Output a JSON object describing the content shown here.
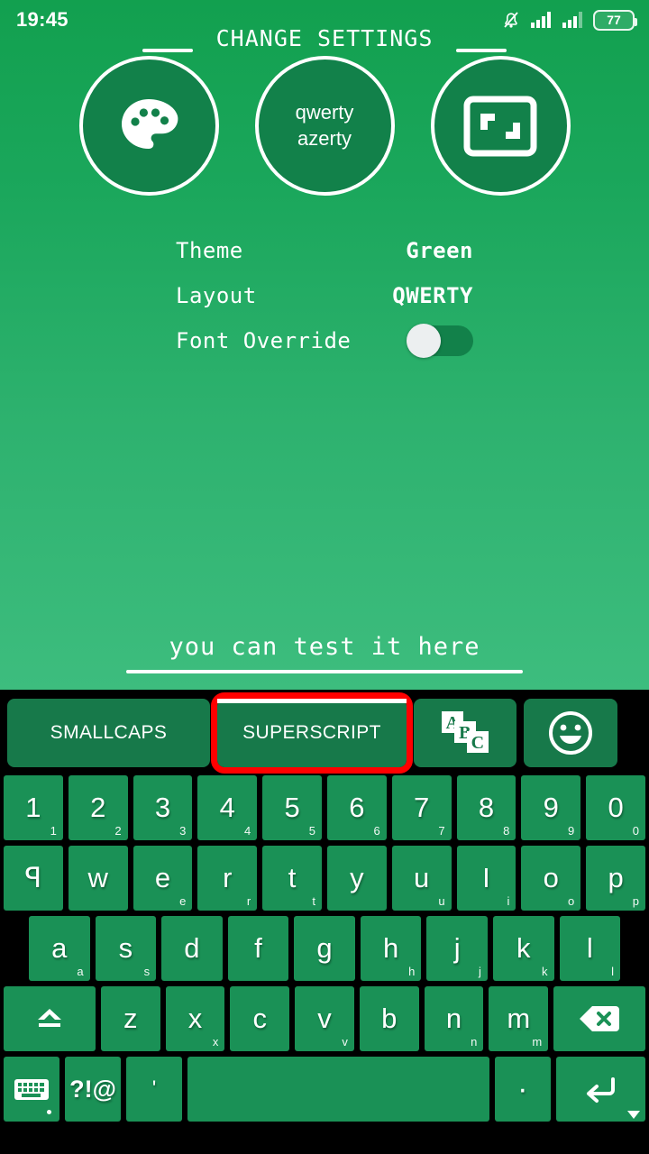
{
  "status_bar": {
    "clock": "19:45",
    "battery_percent": "77",
    "icons": [
      "bell-muted-icon",
      "signal-1-icon",
      "signal-2-icon",
      "battery-icon"
    ]
  },
  "header": {
    "title": "CHANGE SETTINGS"
  },
  "circle_buttons": [
    {
      "name": "theme-button",
      "icon": "palette-icon",
      "label": ""
    },
    {
      "name": "layout-button",
      "icon": "",
      "label_line1": "qwerty",
      "label_line2": "azerty"
    },
    {
      "name": "keyboard-size-button",
      "icon": "resize-icon",
      "label": ""
    }
  ],
  "settings": [
    {
      "label": "Theme",
      "value": "Green",
      "type": "text"
    },
    {
      "label": "Layout",
      "value": "QWERTY",
      "type": "text"
    },
    {
      "label": "Font Override",
      "value": "off",
      "type": "toggle"
    }
  ],
  "test_field": {
    "placeholder": "you can test it here",
    "value": ""
  },
  "toolbar": {
    "smallcaps_label": "SMALLCAPS",
    "superscript_label": "SUPERSCRIPT",
    "abc_icon": "abc-style-icon",
    "emoji_icon": "emoji-smiley-icon",
    "selected": "SUPERSCRIPT"
  },
  "keyboard": {
    "row_numbers": [
      {
        "main": "1",
        "hint": "1"
      },
      {
        "main": "2",
        "hint": "2"
      },
      {
        "main": "3",
        "hint": "3"
      },
      {
        "main": "4",
        "hint": "4"
      },
      {
        "main": "5",
        "hint": "5"
      },
      {
        "main": "6",
        "hint": "6"
      },
      {
        "main": "7",
        "hint": "7"
      },
      {
        "main": "8",
        "hint": "8"
      },
      {
        "main": "9",
        "hint": "9"
      },
      {
        "main": "0",
        "hint": "0"
      }
    ],
    "row_top": [
      {
        "main": "ꟼ",
        "hint": ""
      },
      {
        "main": "w",
        "hint": ""
      },
      {
        "main": "e",
        "hint": "e"
      },
      {
        "main": "r",
        "hint": "r"
      },
      {
        "main": "t",
        "hint": "t"
      },
      {
        "main": "y",
        "hint": ""
      },
      {
        "main": "u",
        "hint": "u"
      },
      {
        "main": "I",
        "hint": "i"
      },
      {
        "main": "o",
        "hint": "o"
      },
      {
        "main": "p",
        "hint": "p"
      }
    ],
    "row_home": [
      {
        "main": "a",
        "hint": "a"
      },
      {
        "main": "s",
        "hint": "s"
      },
      {
        "main": "d",
        "hint": ""
      },
      {
        "main": "f",
        "hint": ""
      },
      {
        "main": "g",
        "hint": ""
      },
      {
        "main": "h",
        "hint": "h"
      },
      {
        "main": "j",
        "hint": "j"
      },
      {
        "main": "k",
        "hint": "k"
      },
      {
        "main": "l",
        "hint": "l"
      }
    ],
    "row_bottom": [
      {
        "main": "z",
        "hint": ""
      },
      {
        "main": "x",
        "hint": "x"
      },
      {
        "main": "c",
        "hint": ""
      },
      {
        "main": "v",
        "hint": "v"
      },
      {
        "main": "b",
        "hint": ""
      },
      {
        "main": "n",
        "hint": "n"
      },
      {
        "main": "m",
        "hint": "m"
      }
    ],
    "shift_key": "shift-icon",
    "backspace_key": "backspace-icon",
    "switch_keyboard_key": "keyboard-switch-icon",
    "symbols_key": "?!@",
    "apostrophe_key": "'",
    "space_key": "",
    "period_key": "·",
    "enter_key": "enter-icon"
  },
  "colors": {
    "theme_green": "#1a9156",
    "dark_green": "#12814a",
    "selection_red": "#ff0000",
    "keyboard_bg": "#000000",
    "white": "#ffffff"
  }
}
